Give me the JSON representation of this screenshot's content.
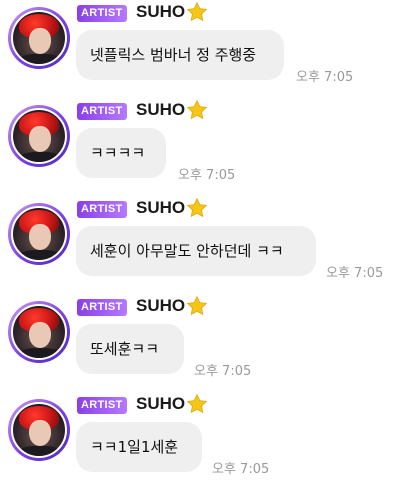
{
  "artist_badge": "ARTIST",
  "colors": {
    "badge_start": "#8b3fe6",
    "badge_end": "#b47aff",
    "bubble": "#efefef",
    "timestamp": "#9a9a9a",
    "avatar_ring": "#7b3fe0"
  },
  "messages": [
    {
      "sender": "SUHO",
      "badge": "ARTIST",
      "text": "넷플릭스 범바너 정 주행중",
      "time": "오후 7:05"
    },
    {
      "sender": "SUHO",
      "badge": "ARTIST",
      "text": "ㅋㅋㅋㅋ",
      "time": "오후 7:05"
    },
    {
      "sender": "SUHO",
      "badge": "ARTIST",
      "text": "세훈이 아무말도 안하던데 ㅋㅋ",
      "time": "오후 7:05"
    },
    {
      "sender": "SUHO",
      "badge": "ARTIST",
      "text": "또세훈ㅋㅋ",
      "time": "오후 7:05"
    },
    {
      "sender": "SUHO",
      "badge": "ARTIST",
      "text": "ㅋㅋ1일1세훈",
      "time": "오후 7:05"
    }
  ]
}
